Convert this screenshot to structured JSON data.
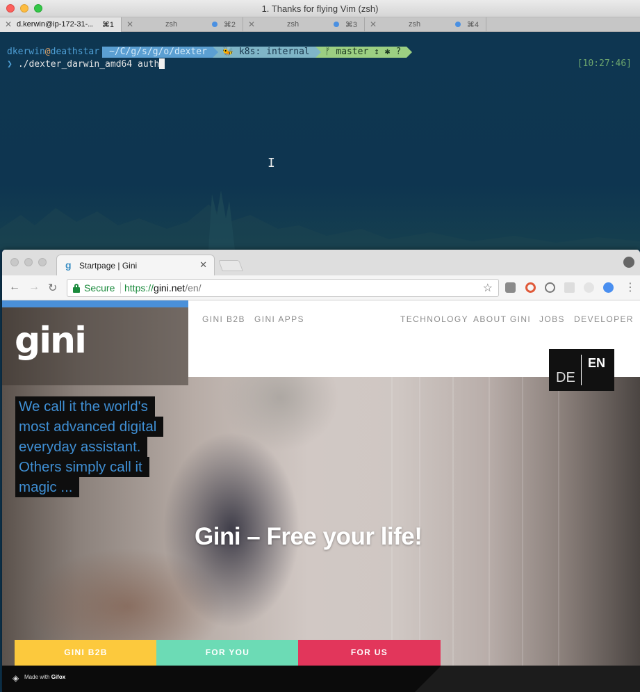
{
  "terminal": {
    "title": "1. Thanks for flying Vim (zsh)",
    "tabs": [
      {
        "label": "d.kerwin@ip-172-31-...",
        "shortcut": "⌘1",
        "active": true
      },
      {
        "label": "zsh",
        "shortcut": "⌘2",
        "active": false
      },
      {
        "label": "zsh",
        "shortcut": "⌘3",
        "active": false
      },
      {
        "label": "zsh",
        "shortcut": "⌘4",
        "active": false
      }
    ],
    "prompt": {
      "user": "dkerwin",
      "at": "@",
      "host": "deathstar",
      "path": "~/C/g/s/g/o/dexter",
      "k8s": "🐝 k8s: internal",
      "git": "ᚠ master ↕ ✱ ?"
    },
    "command": "./dexter_darwin_amd64 auth",
    "clock": "[10:27:46]"
  },
  "browser": {
    "tab_title": "Startpage | Gini",
    "secure_label": "Secure",
    "url_scheme": "https://",
    "url_host": "gini.net",
    "url_path": "/en/"
  },
  "site": {
    "logo": "gini",
    "nav_left": [
      "GINI B2B",
      "GINI APPS"
    ],
    "nav_right": [
      "TECHNOLOGY",
      "ABOUT GINI",
      "JOBS",
      "DEVELOPER"
    ],
    "lang_de": "DE",
    "lang_en": "EN",
    "tagline": [
      "We call it the world's",
      "most advanced digital",
      "everyday assistant.",
      "Others simply call it",
      "magic ..."
    ],
    "hero": "Gini – Free your life!",
    "cta": [
      "GINI B2B",
      "FOR YOU",
      "FOR US"
    ],
    "cta_colors": [
      "#fcc93d",
      "#6cdbb5",
      "#e2365b"
    ],
    "gifox_prefix": "Made with",
    "gifox_brand": "Gifox"
  }
}
